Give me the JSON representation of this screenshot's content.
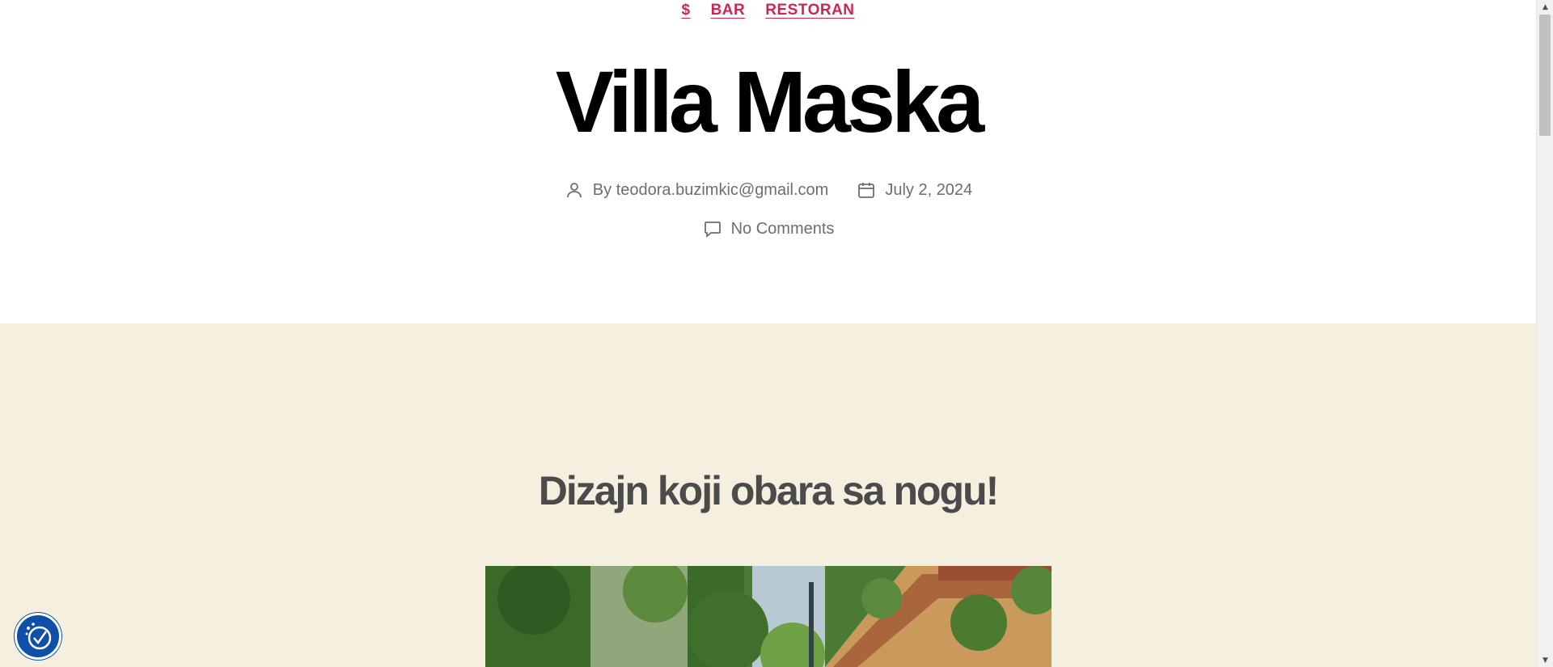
{
  "categories": [
    {
      "label": "$"
    },
    {
      "label": "BAR"
    },
    {
      "label": "RESTORAN"
    }
  ],
  "post": {
    "title": "Villa Maska",
    "author_prefix": "By ",
    "author": "teodora.buzimkic@gmail.com",
    "date": "July 2, 2024",
    "comments": "No Comments"
  },
  "content": {
    "heading": "Dizajn koji obara sa nogu!"
  },
  "icons": {
    "author": "person-icon",
    "date": "calendar-icon",
    "comments": "comment-icon",
    "accessibility": "accessibility-icon"
  },
  "colors": {
    "accent": "#cd2653",
    "content_bg": "#f5efe0",
    "meta_text": "#6d6d6d",
    "a11y_button": "#0f4fa8"
  }
}
